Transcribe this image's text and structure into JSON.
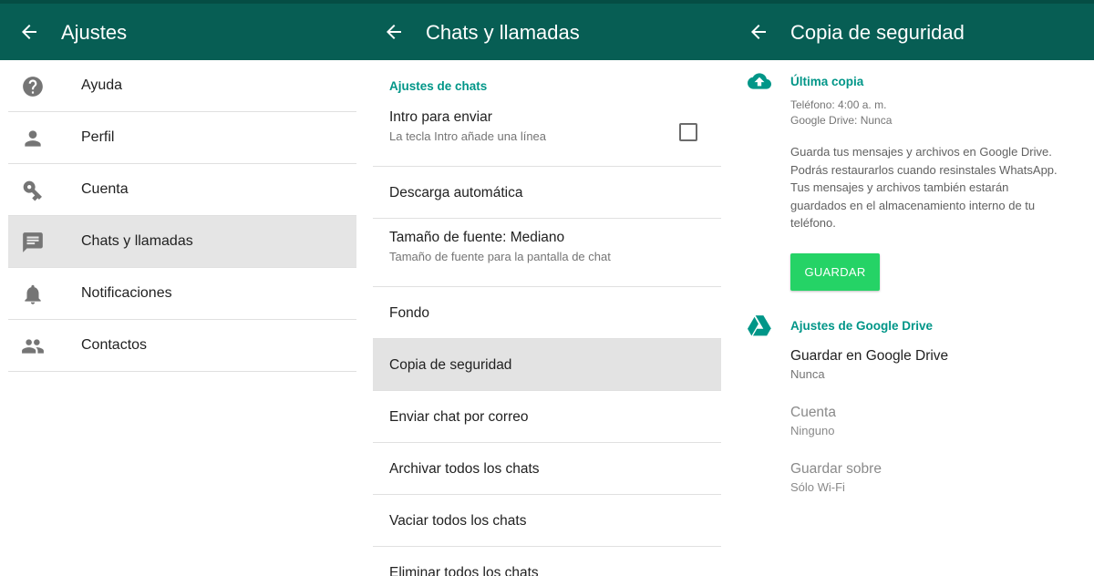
{
  "colors": {
    "appbar": "#075e54",
    "accent_text": "#009688",
    "save_button": "#25d366",
    "selected_row": "#e5e5e5"
  },
  "settings_panel": {
    "title": "Ajustes",
    "items": [
      {
        "label": "Ayuda",
        "icon": "help-icon"
      },
      {
        "label": "Perfil",
        "icon": "person-icon"
      },
      {
        "label": "Cuenta",
        "icon": "key-icon"
      },
      {
        "label": "Chats y llamadas",
        "icon": "chat-icon",
        "selected": true
      },
      {
        "label": "Notificaciones",
        "icon": "bell-icon"
      },
      {
        "label": "Contactos",
        "icon": "contacts-icon"
      }
    ]
  },
  "chats_panel": {
    "title": "Chats y llamadas",
    "section_header": "Ajustes de chats",
    "items": [
      {
        "title": "Intro para enviar",
        "subtitle": "La tecla Intro añade una línea",
        "checked": false
      },
      {
        "title": "Descarga automática"
      },
      {
        "title": "Tamaño de fuente: Mediano",
        "subtitle": "Tamaño de fuente para la pantalla de chat"
      },
      {
        "title": "Fondo"
      },
      {
        "title": "Copia de seguridad",
        "selected": true
      },
      {
        "title": "Enviar chat por correo"
      },
      {
        "title": "Archivar todos los chats"
      },
      {
        "title": "Vaciar todos los chats"
      },
      {
        "title": "Eliminar todos los chats"
      }
    ]
  },
  "backup_panel": {
    "title": "Copia de seguridad",
    "last_backup": {
      "header": "Última copia",
      "phone": "Teléfono: 4:00 a. m.",
      "drive": "Google Drive: Nunca",
      "description": "Guarda tus mensajes y archivos en Google Drive. Podrás restaurarlos cuando resinstales WhatsApp. Tus mensajes y archivos también estarán guardados en el almacenamiento interno de tu teléfono.",
      "button": "GUARDAR"
    },
    "drive_settings": {
      "header": "Ajustes de Google Drive",
      "prefs": [
        {
          "title": "Guardar en Google Drive",
          "value": "Nunca",
          "enabled": true
        },
        {
          "title": "Cuenta",
          "value": "Ninguno",
          "enabled": false
        },
        {
          "title": "Guardar sobre",
          "value": "Sólo Wi-Fi",
          "enabled": false
        }
      ]
    }
  }
}
